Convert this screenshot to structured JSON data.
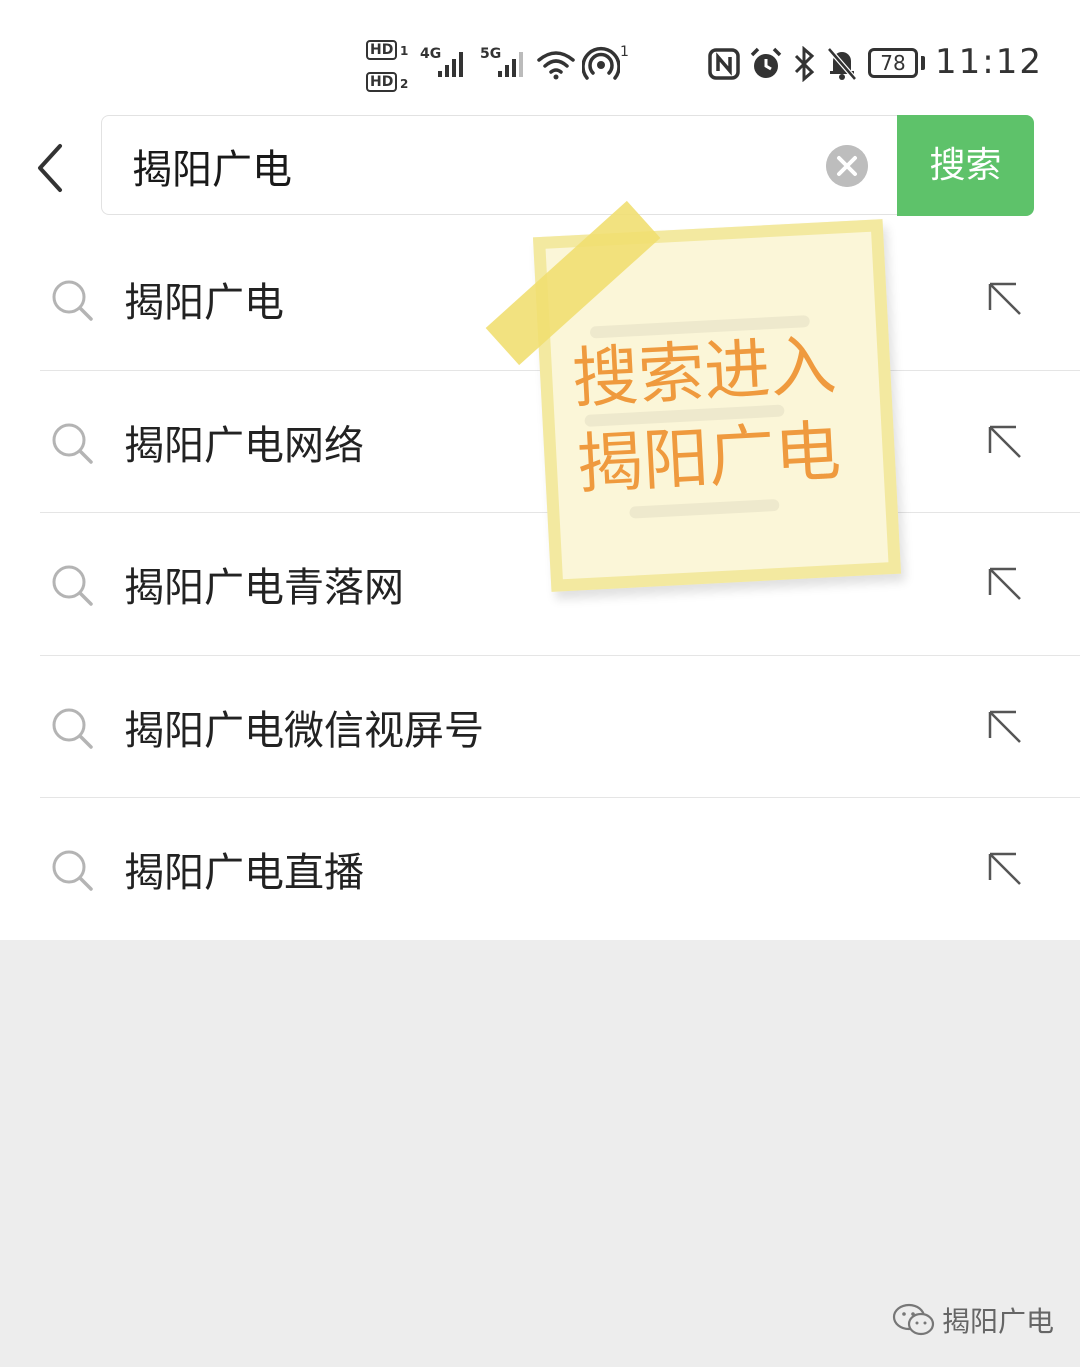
{
  "status_bar": {
    "sim1_label": "HD",
    "sim1_slot": "1",
    "sim2_label": "HD",
    "sim2_slot": "2",
    "network1": "4G",
    "network2": "5G",
    "hotspot_count": "1",
    "battery": "78",
    "time": "11:12",
    "icons": [
      "nfc-icon",
      "alarm-icon",
      "bluetooth-icon",
      "mute-icon",
      "wifi-icon",
      "hotspot-icon"
    ]
  },
  "search": {
    "query": "揭阳广电",
    "button_label": "搜索"
  },
  "suggestions": [
    {
      "label": "揭阳广电"
    },
    {
      "label": "揭阳广电网络"
    },
    {
      "label": "揭阳广电青落网"
    },
    {
      "label": "揭阳广电微信视屏号"
    },
    {
      "label": "揭阳广电直播"
    }
  ],
  "note": {
    "line1": "搜索进入",
    "line2": "揭阳广电"
  },
  "watermark": {
    "text": "揭阳广电"
  },
  "colors": {
    "accent_green": "#5ec26a",
    "note_text": "#ef9a3e",
    "note_bg": "#fbf6d8",
    "page_bg": "#ededed"
  }
}
